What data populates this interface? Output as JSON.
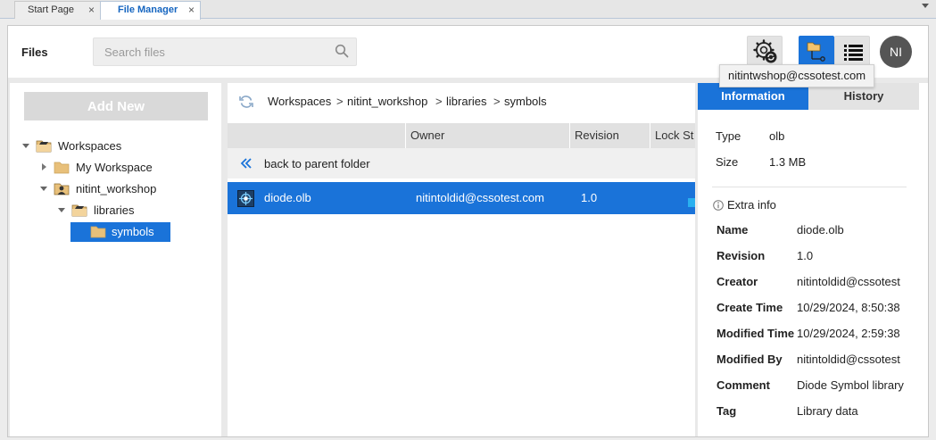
{
  "tabs": [
    {
      "label": "Start Page",
      "close": "×"
    },
    {
      "label": "File Manager",
      "close": "×"
    }
  ],
  "header": {
    "title": "Files",
    "search_placeholder": "Search files",
    "avatar_initials": "NI",
    "tooltip": "nitintwshop@cssotest.com"
  },
  "left": {
    "add_new_label": "Add New",
    "tree": [
      {
        "label": "Workspaces"
      },
      {
        "label": "My Workspace"
      },
      {
        "label": "nitint_workshop"
      },
      {
        "label": "libraries"
      },
      {
        "label": "symbols"
      }
    ]
  },
  "center": {
    "breadcrumb": [
      "Workspaces",
      "nitint_workshop",
      "libraries",
      "symbols"
    ],
    "breadcrumb_sep": ">",
    "columns": [
      "",
      "Owner",
      "Revision",
      "Lock St"
    ],
    "back_label": "back to parent folder",
    "rows": [
      {
        "name": "diode.olb",
        "owner": "nitintoldid@cssotest.com",
        "revision": "1.0"
      }
    ]
  },
  "right": {
    "tabs": [
      "Information",
      "History"
    ],
    "summary": [
      {
        "key": "Type",
        "value": "olb"
      },
      {
        "key": "Size",
        "value": "1.3 MB"
      }
    ],
    "extra_title": "Extra info",
    "extra": [
      {
        "key": "Name",
        "value": "diode.olb"
      },
      {
        "key": "Revision",
        "value": "1.0"
      },
      {
        "key": "Creator",
        "value": "nitintoldid@cssotest"
      },
      {
        "key": "Create Time",
        "value": "10/29/2024, 8:50:38"
      },
      {
        "key": "Modified Time",
        "value": "10/29/2024, 2:59:38"
      },
      {
        "key": "Modified By",
        "value": "nitintoldid@cssotest"
      },
      {
        "key": "Comment",
        "value": "Diode Symbol library"
      },
      {
        "key": "Tag",
        "value": "Library data"
      }
    ]
  },
  "colors": {
    "accent": "#1a73d9",
    "folder": "#e8c07a",
    "lock_status": "#29b0f0"
  },
  "icons": {
    "search": "search-icon",
    "settings_sync": "settings-sync-icon",
    "tree_view": "tree-view-icon",
    "list_view": "list-view-icon",
    "refresh": "refresh-icon",
    "back": "double-chevron-left-icon",
    "file": "olb-file-icon",
    "info": "info-icon"
  }
}
